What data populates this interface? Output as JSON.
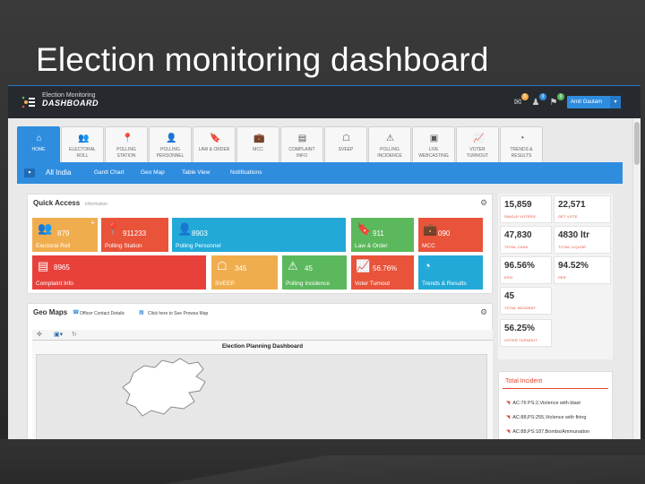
{
  "slide": {
    "title": "Election monitoring dashboard"
  },
  "app": {
    "logo_line1": "Election Monitoring",
    "logo_line2": "DASHBOARD",
    "user_name": "Amit Gautam",
    "notifications": [
      {
        "icon": "envelope-icon",
        "count": "5",
        "color": "#f0ad4e"
      },
      {
        "icon": "user-group-icon",
        "count": "9",
        "color": "#2f8de0"
      },
      {
        "icon": "flag-icon",
        "count": "9",
        "color": "#5cb85c"
      }
    ]
  },
  "tabs": [
    {
      "label1": "HOME",
      "label2": "",
      "icon": "home-icon",
      "glyph": "⌂"
    },
    {
      "label1": "ELECTORAL",
      "label2": "ROLL",
      "icon": "people-icon",
      "glyph": "👥"
    },
    {
      "label1": "POLLING",
      "label2": "STATION",
      "icon": "map-pin-icon",
      "glyph": "📍"
    },
    {
      "label1": "POLLING",
      "label2": "PERSONNEL",
      "icon": "person-icon",
      "glyph": "👤"
    },
    {
      "label1": "LAW & ORDER",
      "label2": "",
      "icon": "bookmark-icon",
      "glyph": "🔖"
    },
    {
      "label1": "MCC",
      "label2": "",
      "icon": "briefcase-icon",
      "glyph": "💼"
    },
    {
      "label1": "COMPLAINT",
      "label2": "INFO",
      "icon": "document-icon",
      "glyph": "▤"
    },
    {
      "label1": "SVEEP",
      "label2": "",
      "icon": "network-icon",
      "glyph": "☖"
    },
    {
      "label1": "POLLING",
      "label2": "INCIDENCE",
      "icon": "warning-icon",
      "glyph": "⚠"
    },
    {
      "label1": "LIVE",
      "label2": "WEBCASTING",
      "icon": "camera-icon",
      "glyph": "▣"
    },
    {
      "label1": "VOTER",
      "label2": "TURNOUT",
      "icon": "chart-icon",
      "glyph": "📈"
    },
    {
      "label1": "TRENDS &",
      "label2": "RESULTS",
      "icon": "pie-icon",
      "glyph": "◔"
    }
  ],
  "subnav": {
    "main": "All India",
    "items": [
      "Gantt Chart",
      "Geo Map",
      "Table View",
      "Notifications"
    ]
  },
  "quick_access": {
    "title": "Quick Access",
    "subtitle": "Information",
    "tiles": [
      {
        "value": "879",
        "label": "Electoral Roll",
        "color": "#f0ad4e",
        "icon": "people-icon",
        "glyph": "👥"
      },
      {
        "value": "911233",
        "label": "Polling Station",
        "color": "#e8533a",
        "icon": "map-pin-icon",
        "glyph": "📍"
      },
      {
        "value": "8903",
        "label": "Polling Personnel",
        "color": "#23a9d8",
        "icon": "person-icon",
        "glyph": "👤"
      },
      {
        "value": "911",
        "label": "Law & Order",
        "color": "#5cb85c",
        "icon": "bookmark-icon",
        "glyph": "🔖"
      },
      {
        "value": "090",
        "label": "MCC",
        "color": "#e8533a",
        "icon": "briefcase-icon",
        "glyph": "💼"
      },
      {
        "value": "8965",
        "label": "Complaint Info",
        "color": "#e8413c",
        "icon": "document-icon",
        "glyph": "▤"
      },
      {
        "value": "345",
        "label": "SVEEP",
        "color": "#f0ad4e",
        "icon": "network-icon",
        "glyph": "☖"
      },
      {
        "value": "45",
        "label": "Polling Incidence",
        "color": "#5cb85c",
        "icon": "warning-icon",
        "glyph": "⚠"
      },
      {
        "value": "56.76%",
        "label": "Voter Turnout",
        "color": "#e8533a",
        "icon": "chart-icon",
        "glyph": "📈"
      },
      {
        "value": "",
        "label": "Trends & Results",
        "color": "#23a9d8",
        "icon": "pie-icon",
        "glyph": "◔"
      }
    ]
  },
  "stats": [
    {
      "value": "15,859",
      "label": "SINGLE VOTERS"
    },
    {
      "value": "22,571",
      "label": "GET VOTE"
    },
    {
      "value": "47,830",
      "label": "TOTAL CASH"
    },
    {
      "value": "4830 ltr",
      "label": "TOTAL LIQUOR"
    },
    {
      "value": "96.56%",
      "label": "EPIC"
    },
    {
      "value": "94.52%",
      "label": "PER"
    },
    {
      "value": "45",
      "label": "TOTAL INCIDENT"
    },
    {
      "value": "56.25%",
      "label": "VOTER TURNOUT"
    }
  ],
  "geo_maps": {
    "title": "Geo Maps",
    "link1": "Officer Contact Details",
    "link2": "Click here to See Prowsa Map",
    "map_title": "Election Planning Dashboard"
  },
  "incidents": {
    "title": "Total Incident",
    "items": [
      "AC:76 PS:2,Violence with blast",
      "AC:88,PS:255,Violence with firing",
      "AC:88,PS:187,Bombs/Ammunation"
    ]
  }
}
